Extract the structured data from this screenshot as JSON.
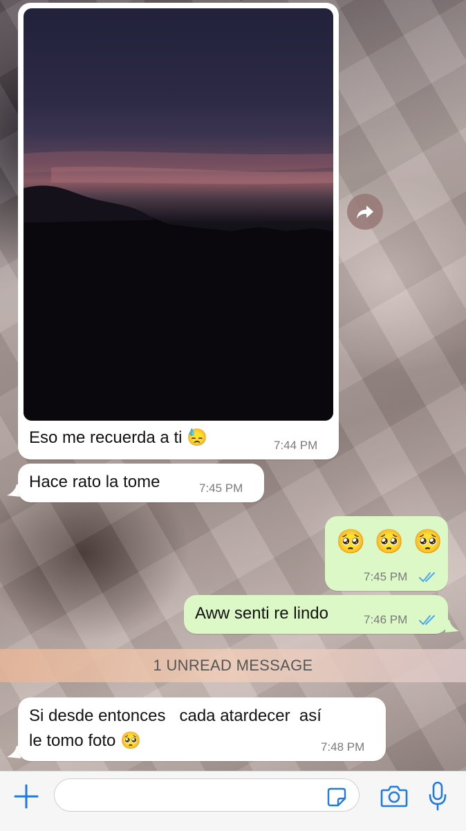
{
  "messages": [
    {
      "text": "Eso me recuerda  a ti 😓",
      "time": "7:44 PM"
    },
    {
      "text": "Hace rato  la tome",
      "time": "7:45 PM"
    },
    {
      "text": "🥺 🥺 🥺",
      "time": "7:45 PM"
    },
    {
      "text": "Aww senti re lindo",
      "time": "7:46 PM"
    },
    {
      "text_line1": "Si desde entonces   cada atardecer  así",
      "text_line2": "le tomo foto 🥺",
      "time": "7:48 PM"
    }
  ],
  "unread": {
    "label": "1 UNREAD MESSAGE"
  },
  "composer": {
    "placeholder": ""
  },
  "icons": {
    "forward": "forward-icon",
    "read_receipt": "double-check-icon",
    "plus": "plus-icon",
    "sticker": "sticker-icon",
    "camera": "camera-icon",
    "mic": "microphone-icon"
  },
  "colors": {
    "incoming_bubble": "#ffffff",
    "outgoing_bubble": "#dcf8c6",
    "accent": "#1f7ae0",
    "read_tick": "#4fa6e8"
  }
}
